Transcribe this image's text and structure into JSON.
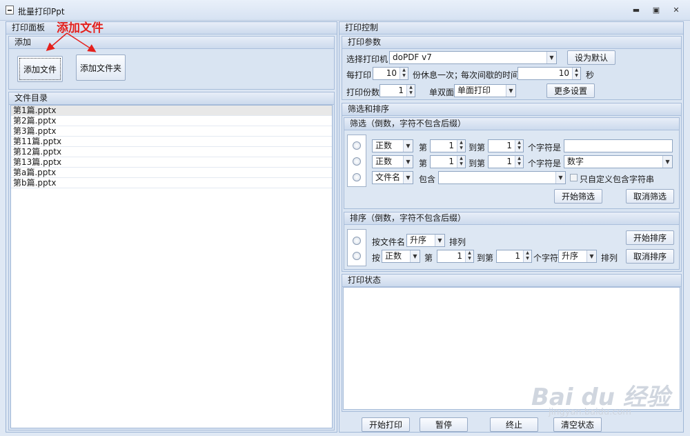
{
  "window": {
    "title": "批量打印Ppt",
    "min": "▬",
    "restore": "▣",
    "close": "✕"
  },
  "annotation": "添加文件",
  "left": {
    "panel_title": "打印面板",
    "add_group": "添加",
    "add_file_btn": "添加文件",
    "add_folder_btn": "添加文件夹",
    "list_group": "文件目录",
    "files": [
      "第1篇.pptx",
      "第2篇.pptx",
      "第3篇.pptx",
      "第11篇.pptx",
      "第12篇.pptx",
      "第13篇.pptx",
      "第a篇.pptx",
      "第b篇.pptx"
    ]
  },
  "right": {
    "panel_title": "打印控制",
    "params": {
      "title": "打印参数",
      "printer_label": "选择打印机",
      "printer_value": "doPDF v7",
      "set_default_btn": "设为默认",
      "per_print_label": "每打印",
      "per_print_value": "10",
      "rest_label": "份休息一次；",
      "interval_label": "每次间歇的时间",
      "interval_value": "10",
      "seconds_label": "秒",
      "copies_label": "打印份数",
      "copies_value": "1",
      "duplex_label": "单双面",
      "duplex_value": "单面打印",
      "more_btn": "更多设置"
    },
    "filter_sort": {
      "title": "筛选和排序",
      "filter": {
        "title": "筛选（倒数，字符不包含后缀）",
        "row1": {
          "mode": "正数",
          "di": "第",
          "from": "1",
          "dao": "到第",
          "to": "1",
          "chars_is": "个字符是",
          "value": ""
        },
        "row2": {
          "mode": "正数",
          "di": "第",
          "from": "1",
          "dao": "到第",
          "to": "1",
          "chars_is": "个字符是",
          "value": "数字"
        },
        "row3": {
          "mode": "文件名",
          "contains": "包含",
          "value": "",
          "custom_only": "只自定义包含字符串"
        },
        "start_btn": "开始筛选",
        "cancel_btn": "取消筛选"
      },
      "sort": {
        "title": "排序（倒数，字符不包含后缀）",
        "row1": {
          "by_name": "按文件名",
          "order": "升序",
          "arrange": "排列"
        },
        "row2": {
          "by": "按",
          "mode": "正数",
          "di": "第",
          "from": "1",
          "dao": "到第",
          "to": "1",
          "chars": "个字符",
          "order": "升序",
          "arrange": "排列"
        },
        "start_btn": "开始排序",
        "cancel_btn": "取消排序"
      }
    },
    "status": {
      "title": "打印状态",
      "content": ""
    },
    "bottom": {
      "start": "开始打印",
      "pause": "暂停",
      "stop": "终止",
      "clear": "清空状态"
    }
  },
  "watermark": {
    "brand": "Bai du 经验",
    "url": "jingyan.baidu.com"
  }
}
